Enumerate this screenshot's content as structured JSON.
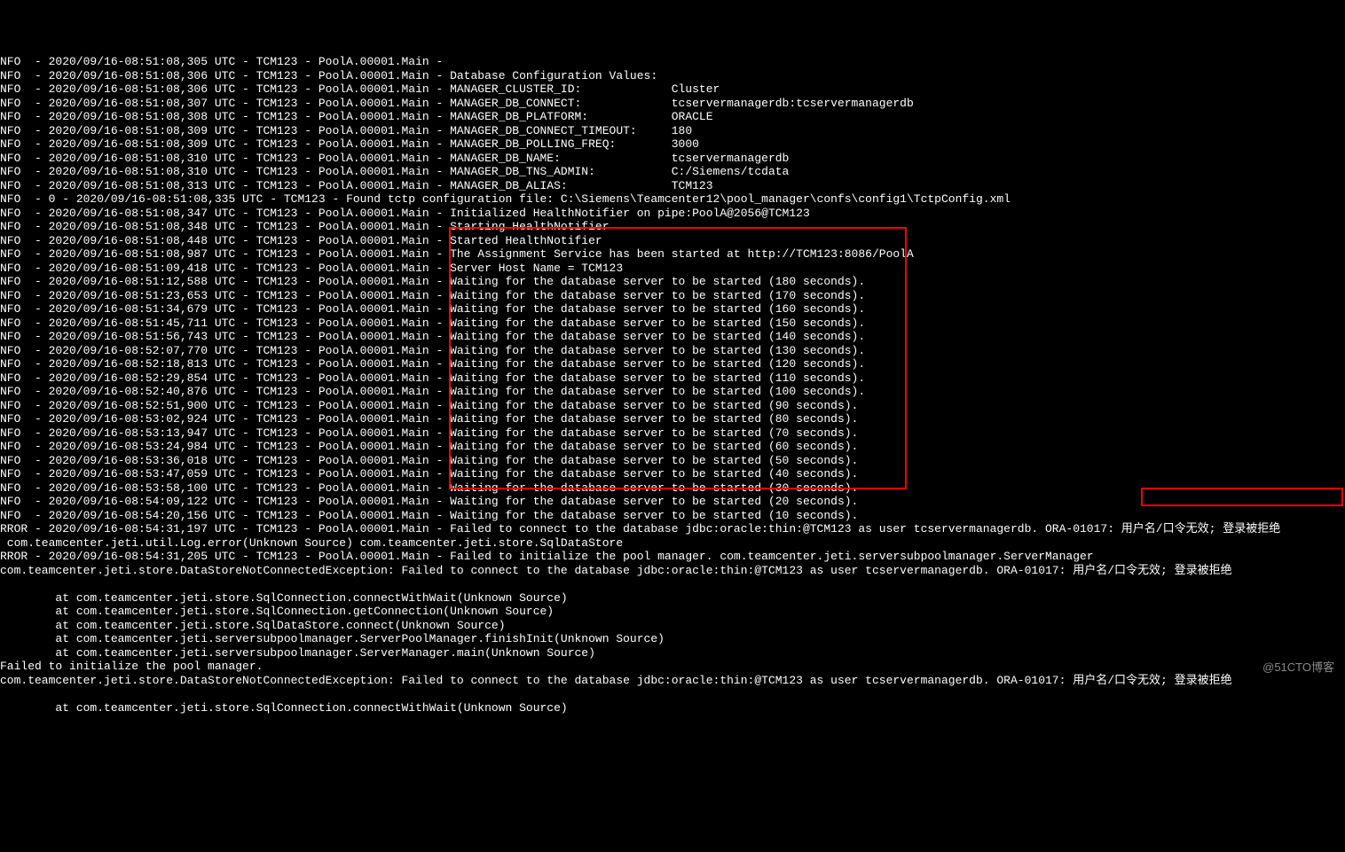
{
  "lines": [
    "NFO  - 2020/09/16-08:51:08,305 UTC - TCM123 - PoolA.00001.Main -",
    "NFO  - 2020/09/16-08:51:08,306 UTC - TCM123 - PoolA.00001.Main - Database Configuration Values:",
    "NFO  - 2020/09/16-08:51:08,306 UTC - TCM123 - PoolA.00001.Main - MANAGER_CLUSTER_ID:             Cluster",
    "NFO  - 2020/09/16-08:51:08,307 UTC - TCM123 - PoolA.00001.Main - MANAGER_DB_CONNECT:             tcservermanagerdb:tcservermanagerdb",
    "NFO  - 2020/09/16-08:51:08,308 UTC - TCM123 - PoolA.00001.Main - MANAGER_DB_PLATFORM:            ORACLE",
    "NFO  - 2020/09/16-08:51:08,309 UTC - TCM123 - PoolA.00001.Main - MANAGER_DB_CONNECT_TIMEOUT:     180",
    "NFO  - 2020/09/16-08:51:08,309 UTC - TCM123 - PoolA.00001.Main - MANAGER_DB_POLLING_FREQ:        3000",
    "NFO  - 2020/09/16-08:51:08,310 UTC - TCM123 - PoolA.00001.Main - MANAGER_DB_NAME:                tcservermanagerdb",
    "NFO  - 2020/09/16-08:51:08,310 UTC - TCM123 - PoolA.00001.Main - MANAGER_DB_TNS_ADMIN:           C:/Siemens/tcdata",
    "NFO  - 2020/09/16-08:51:08,313 UTC - TCM123 - PoolA.00001.Main - MANAGER_DB_ALIAS:               TCM123",
    "NFO  - 0 - 2020/09/16-08:51:08,335 UTC - TCM123 - Found tctp configuration file: C:\\Siemens\\Teamcenter12\\pool_manager\\confs\\config1\\TctpConfig.xml",
    "NFO  - 2020/09/16-08:51:08,347 UTC - TCM123 - PoolA.00001.Main - Initialized HealthNotifier on pipe:PoolA@2056@TCM123",
    "NFO  - 2020/09/16-08:51:08,348 UTC - TCM123 - PoolA.00001.Main - Starting HealthNotifier",
    "NFO  - 2020/09/16-08:51:08,448 UTC - TCM123 - PoolA.00001.Main - Started HealthNotifier",
    "NFO  - 2020/09/16-08:51:08,987 UTC - TCM123 - PoolA.00001.Main - The Assignment Service has been started at http://TCM123:8086/PoolA",
    "NFO  - 2020/09/16-08:51:09,418 UTC - TCM123 - PoolA.00001.Main - Server Host Name = TCM123",
    "NFO  - 2020/09/16-08:51:12,588 UTC - TCM123 - PoolA.00001.Main - Waiting for the database server to be started (180 seconds).",
    "NFO  - 2020/09/16-08:51:23,653 UTC - TCM123 - PoolA.00001.Main - Waiting for the database server to be started (170 seconds).",
    "NFO  - 2020/09/16-08:51:34,679 UTC - TCM123 - PoolA.00001.Main - Waiting for the database server to be started (160 seconds).",
    "NFO  - 2020/09/16-08:51:45,711 UTC - TCM123 - PoolA.00001.Main - Waiting for the database server to be started (150 seconds).",
    "NFO  - 2020/09/16-08:51:56,743 UTC - TCM123 - PoolA.00001.Main - Waiting for the database server to be started (140 seconds).",
    "NFO  - 2020/09/16-08:52:07,770 UTC - TCM123 - PoolA.00001.Main - Waiting for the database server to be started (130 seconds).",
    "NFO  - 2020/09/16-08:52:18,813 UTC - TCM123 - PoolA.00001.Main - Waiting for the database server to be started (120 seconds).",
    "NFO  - 2020/09/16-08:52:29,854 UTC - TCM123 - PoolA.00001.Main - Waiting for the database server to be started (110 seconds).",
    "NFO  - 2020/09/16-08:52:40,876 UTC - TCM123 - PoolA.00001.Main - Waiting for the database server to be started (100 seconds).",
    "NFO  - 2020/09/16-08:52:51,900 UTC - TCM123 - PoolA.00001.Main - Waiting for the database server to be started (90 seconds).",
    "NFO  - 2020/09/16-08:53:02,924 UTC - TCM123 - PoolA.00001.Main - Waiting for the database server to be started (80 seconds).",
    "NFO  - 2020/09/16-08:53:13,947 UTC - TCM123 - PoolA.00001.Main - Waiting for the database server to be started (70 seconds).",
    "NFO  - 2020/09/16-08:53:24,984 UTC - TCM123 - PoolA.00001.Main - Waiting for the database server to be started (60 seconds).",
    "NFO  - 2020/09/16-08:53:36,018 UTC - TCM123 - PoolA.00001.Main - Waiting for the database server to be started (50 seconds).",
    "NFO  - 2020/09/16-08:53:47,059 UTC - TCM123 - PoolA.00001.Main - Waiting for the database server to be started (40 seconds).",
    "NFO  - 2020/09/16-08:53:58,100 UTC - TCM123 - PoolA.00001.Main - Waiting for the database server to be started (30 seconds).",
    "NFO  - 2020/09/16-08:54:09,122 UTC - TCM123 - PoolA.00001.Main - Waiting for the database server to be started (20 seconds).",
    "NFO  - 2020/09/16-08:54:20,156 UTC - TCM123 - PoolA.00001.Main - Waiting for the database server to be started (10 seconds).",
    "RROR - 2020/09/16-08:54:31,197 UTC - TCM123 - PoolA.00001.Main - Failed to connect to the database jdbc:oracle:thin:@TCM123 as user tcservermanagerdb. ORA-01017: 用户名/口令无效; 登录被拒绝",
    " com.teamcenter.jeti.util.Log.error(Unknown Source) com.teamcenter.jeti.store.SqlDataStore",
    "RROR - 2020/09/16-08:54:31,205 UTC - TCM123 - PoolA.00001.Main - Failed to initialize the pool manager. com.teamcenter.jeti.serversubpoolmanager.ServerManager",
    "com.teamcenter.jeti.store.DataStoreNotConnectedException: Failed to connect to the database jdbc:oracle:thin:@TCM123 as user tcservermanagerdb. ORA-01017: 用户名/口令无效; 登录被拒绝",
    "",
    "        at com.teamcenter.jeti.store.SqlConnection.connectWithWait(Unknown Source)",
    "        at com.teamcenter.jeti.store.SqlConnection.getConnection(Unknown Source)",
    "        at com.teamcenter.jeti.store.SqlDataStore.connect(Unknown Source)",
    "        at com.teamcenter.jeti.serversubpoolmanager.ServerPoolManager.finishInit(Unknown Source)",
    "        at com.teamcenter.jeti.serversubpoolmanager.ServerManager.main(Unknown Source)",
    "Failed to initialize the pool manager.",
    "com.teamcenter.jeti.store.DataStoreNotConnectedException: Failed to connect to the database jdbc:oracle:thin:@TCM123 as user tcservermanagerdb. ORA-01017: 用户名/口令无效; 登录被拒绝",
    "",
    "        at com.teamcenter.jeti.store.SqlConnection.connectWithWait(Unknown Source)"
  ],
  "watermark": "@51CTO博客"
}
